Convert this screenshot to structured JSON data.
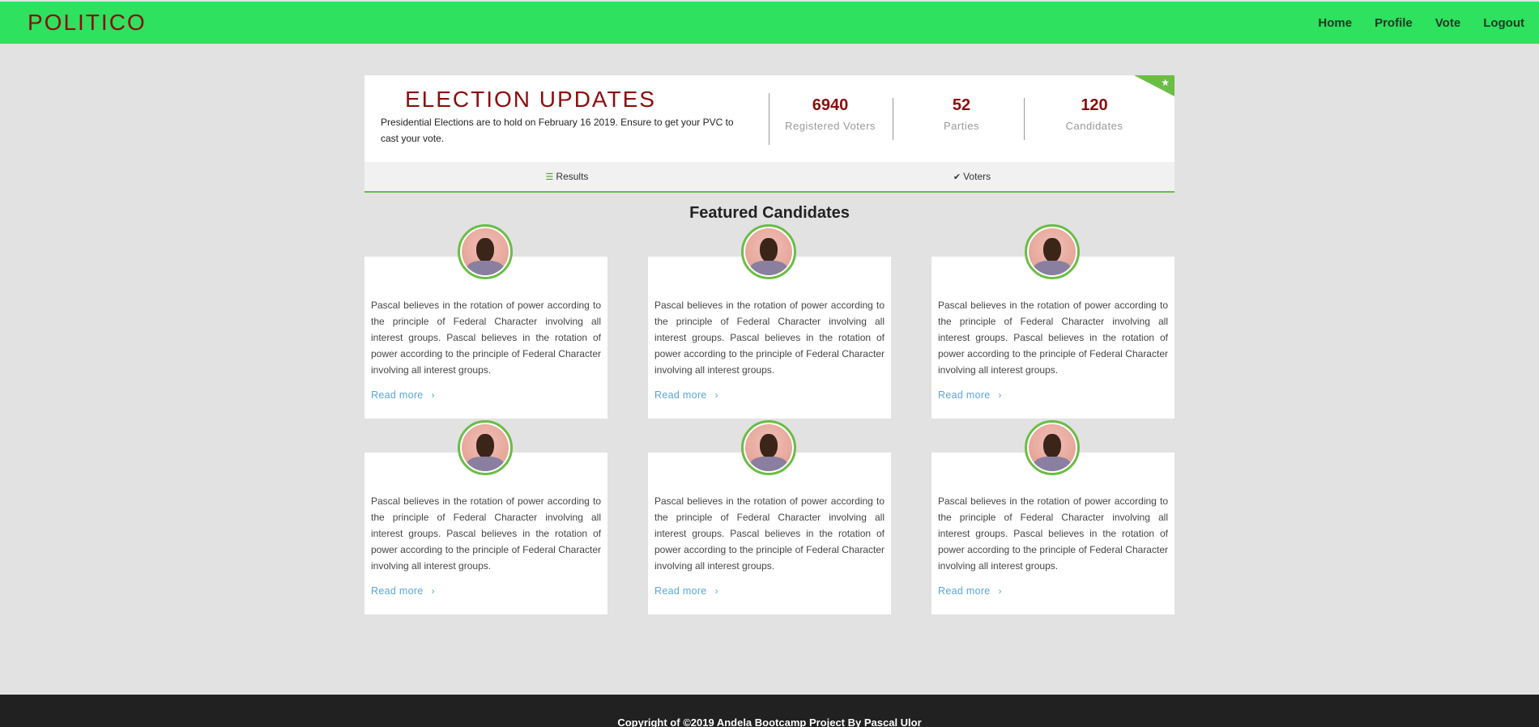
{
  "navbar": {
    "brand": "POLITICO",
    "links": [
      "Home",
      "Profile",
      "Vote",
      "Logout"
    ],
    "color": "#2ee15e"
  },
  "updates": {
    "title": "ELECTION UPDATES",
    "description": "Presidential Elections are to hold on February 16 2019. Ensure to get your PVC to cast your vote.",
    "stats": [
      {
        "value": "6940",
        "label": "Registered Voters"
      },
      {
        "value": "52",
        "label": "Parties"
      },
      {
        "value": "120",
        "label": "Candidates"
      }
    ],
    "ribbon_icon": "star-icon"
  },
  "tabs": [
    {
      "label": "Results",
      "icon": "list-icon"
    },
    {
      "label": "Voters",
      "icon": "check-icon"
    }
  ],
  "featured": {
    "title": "Featured Candidates",
    "cards": [
      {
        "text": "Pascal believes in the rotation of power according to the principle of Federal Character involving all interest groups. Pascal believes in the rotation of power according to the principle of Federal Character involving all interest groups.",
        "link": "Read more"
      },
      {
        "text": "Pascal believes in the rotation of power according to the principle of Federal Character involving all interest groups. Pascal believes in the rotation of power according to the principle of Federal Character involving all interest groups.",
        "link": "Read more"
      },
      {
        "text": "Pascal believes in the rotation of power according to the principle of Federal Character involving all interest groups. Pascal believes in the rotation of power according to the principle of Federal Character involving all interest groups.",
        "link": "Read more"
      },
      {
        "text": "Pascal believes in the rotation of power according to the principle of Federal Character involving all interest groups. Pascal believes in the rotation of power according to the principle of Federal Character involving all interest groups.",
        "link": "Read more"
      },
      {
        "text": "Pascal believes in the rotation of power according to the principle of Federal Character involving all interest groups. Pascal believes in the rotation of power according to the principle of Federal Character involving all interest groups.",
        "link": "Read more"
      },
      {
        "text": "Pascal believes in the rotation of power according to the principle of Federal Character involving all interest groups. Pascal believes in the rotation of power according to the principle of Federal Character involving all interest groups.",
        "link": "Read more"
      }
    ]
  },
  "footer": {
    "text": "Copyright of ©2019 Andela Bootcamp Project By Pascal Ulor"
  }
}
